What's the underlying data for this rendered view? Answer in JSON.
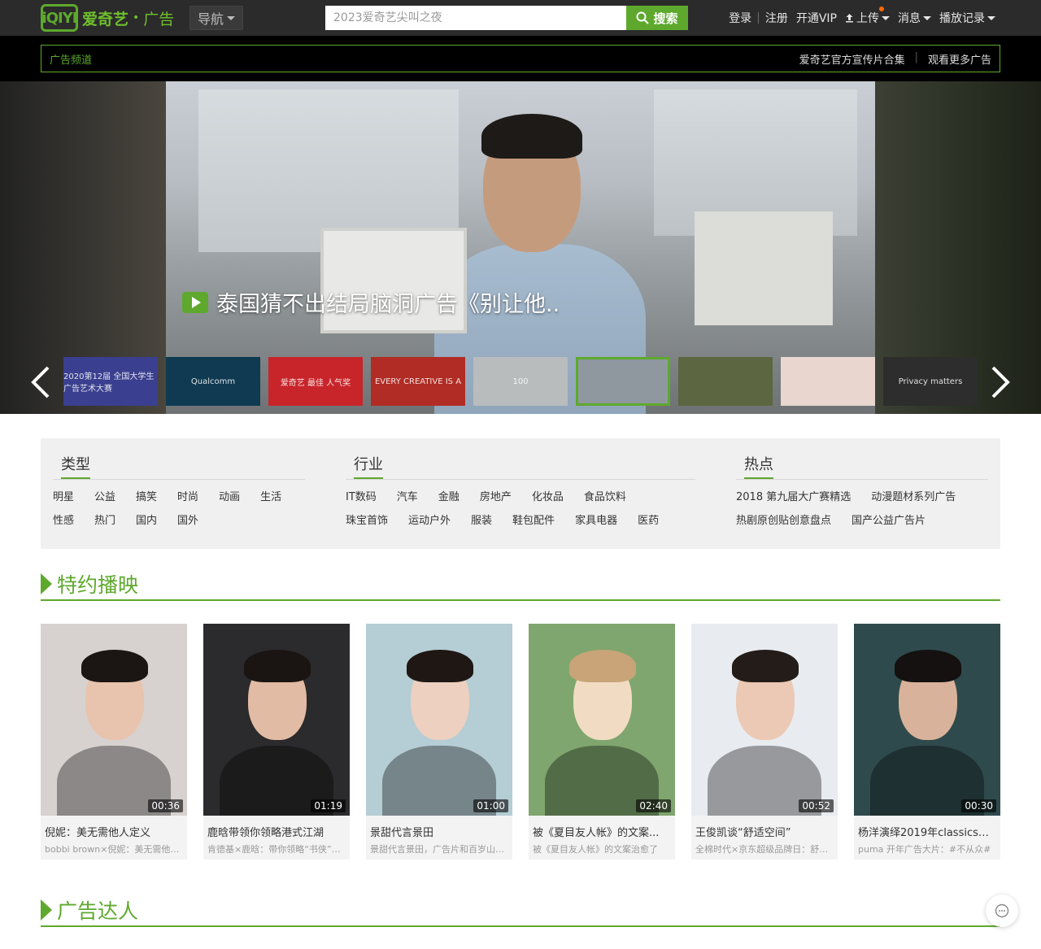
{
  "header": {
    "logo_text": "iQIYI",
    "brand_name": "爱奇艺",
    "brand_sub": "广告",
    "nav_label": "导航",
    "search_placeholder": "2023爱奇艺尖叫之夜",
    "search_button": "搜索",
    "user_links": {
      "login": "登录",
      "register": "注册",
      "vip": "开通VIP",
      "upload": "上传",
      "messages": "消息",
      "history": "播放记录"
    }
  },
  "channel": {
    "title": "广告频道",
    "links": [
      "爱奇艺官方宣传片合集",
      "观看更多广告"
    ]
  },
  "hero": {
    "title": "泰国猜不出结局脑洞广告《别让他..",
    "thumbnails": [
      {
        "label": "2020第12届 全国大学生 广告艺术大赛",
        "color": "#3a3f8f"
      },
      {
        "label": "Qualcomm",
        "color": "#0f3a52"
      },
      {
        "label": "爱奇艺 最佳 人气奖",
        "color": "#c8252a"
      },
      {
        "label": "EVERY CREATIVE IS A",
        "color": "#b12c24"
      },
      {
        "label": "100",
        "color": "#b9bcbd"
      },
      {
        "label": "",
        "color": "#8f989f"
      },
      {
        "label": "",
        "color": "#5c6640"
      },
      {
        "label": "",
        "color": "#e8d6cf"
      },
      {
        "label": "Privacy matters",
        "color": "#2d2d2d"
      }
    ],
    "active_index": 5
  },
  "categories": {
    "groups": [
      {
        "title": "类型",
        "rows": [
          [
            "明星",
            "公益",
            "搞笑",
            "时尚",
            "动画",
            "生活"
          ],
          [
            "性感",
            "热门",
            "国内",
            "国外"
          ]
        ]
      },
      {
        "title": "行业",
        "rows": [
          [
            "IT数码",
            "汽车",
            "金融",
            "房地产",
            "化妆品",
            "食品饮料"
          ],
          [
            "珠宝首饰",
            "运动户外",
            "服装",
            "鞋包配件",
            "家具电器",
            "医药"
          ]
        ]
      },
      {
        "title": "热点",
        "rows": [
          [
            "2018 第九届大广赛精选",
            "动漫题材系列广告"
          ],
          [
            "热剧原创贴创意盘点",
            "国产公益广告片"
          ]
        ]
      }
    ]
  },
  "featured": {
    "title": "特约播映",
    "items": [
      {
        "duration": "00:36",
        "title": "倪妮：美无需他人定义",
        "desc": "bobbi brown×倪妮：美无需他人定义",
        "bg": "#d7d2cf",
        "skin": "#e8c3ad",
        "hair": "#1b1613"
      },
      {
        "duration": "01:19",
        "title": "鹿晗带领你领略港式江湖",
        "desc": "肯德基×鹿晗：带你领略“书侠”江湖",
        "bg": "#2b2a2c",
        "skin": "#e1bba3",
        "hair": "#1a1512"
      },
      {
        "duration": "01:00",
        "title": "景甜代言景田",
        "desc": "景甜代言景田，广告片和百岁山一样",
        "bg": "#b5cdd4",
        "skin": "#edd0bf",
        "hair": "#1f1714"
      },
      {
        "duration": "02:40",
        "title": "被《夏目友人帐》的文案...",
        "desc": "被《夏目友人帐》的文案治愈了",
        "bg": "#7fa66e",
        "skin": "#f1dcc3",
        "hair": "#c8a478"
      },
      {
        "duration": "00:52",
        "title": "王俊凯谈“舒适空间”",
        "desc": "全棉时代×京东超级品牌日：舒适空间",
        "bg": "#e8ecf0",
        "skin": "#ecc9b4",
        "hair": "#241c18"
      },
      {
        "duration": "00:30",
        "title": "杨洋演绎2019年classics系...",
        "desc": "puma 开年广告大片：#不从众#",
        "bg": "#2f4a4c",
        "skin": "#d8b29a",
        "hair": "#141110"
      }
    ]
  },
  "experts": {
    "title": "广告达人"
  },
  "colors": {
    "accent": "#5ea92d",
    "topbar": "#2b2b2b"
  }
}
